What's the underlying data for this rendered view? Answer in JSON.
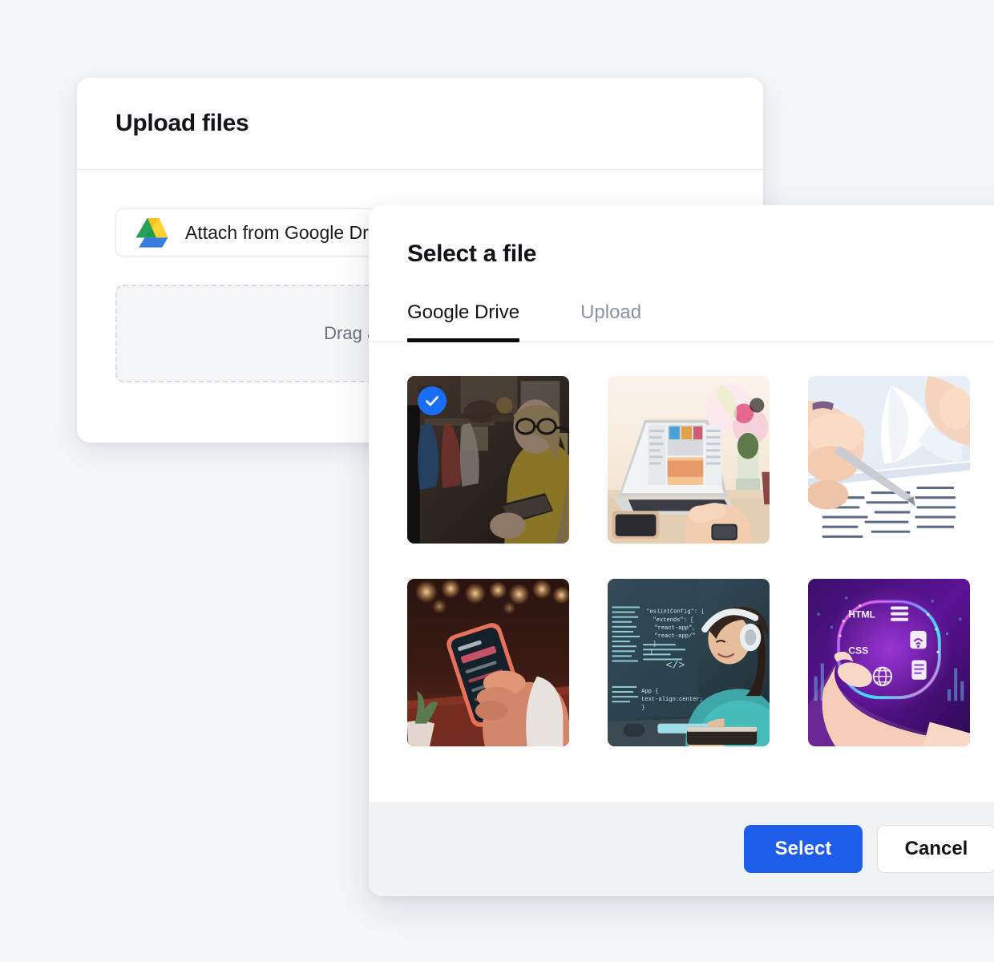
{
  "page": {
    "background_color": "#f4f6f9"
  },
  "upload_dialog": {
    "title": "Upload files",
    "attach_button": {
      "label": "Attach from Google Drive",
      "icon": "google-drive-icon"
    },
    "dropzone": {
      "text": "Drag and Drop files here",
      "style": "dashed"
    }
  },
  "select_dialog": {
    "title": "Select a file",
    "tabs": [
      {
        "label": "Google Drive",
        "active": true
      },
      {
        "label": "Upload",
        "active": false
      }
    ],
    "files": [
      {
        "name": "woman-in-yellow-dress-with-tablet-in-boutique",
        "selected": true,
        "alt": "Blonde woman with glasses in yellow dress holding a tablet in a clothing store"
      },
      {
        "name": "laptop-with-social-feed-on-desk",
        "selected": false,
        "alt": "Hands using a laptop showing a social media feed, phone and cactus on a bright desk"
      },
      {
        "name": "hands-reviewing-document-with-pen",
        "selected": false,
        "alt": "Close-up of hands turning a page of a printed document while holding a pen"
      },
      {
        "name": "hand-holding-phone-in-warm-bokeh-light",
        "selected": false,
        "alt": "Hand holding a smartphone at night with warm orange bokeh lights"
      },
      {
        "name": "woman-with-headphones-coding",
        "selected": false,
        "alt": "Woman in teal sweater wearing headphones typing with floating blue code overlay"
      },
      {
        "name": "neon-html-css-tech-graphic",
        "selected": false,
        "alt": "Hand holding a glowing purple neon ring with HTML and CSS labels and tech icons"
      }
    ],
    "footer": {
      "select_label": "Select",
      "cancel_label": "Cancel",
      "select_color": "#1d5dea",
      "background_color": "#f1f2f4"
    },
    "checkmark_color": "#1a6ef5"
  }
}
